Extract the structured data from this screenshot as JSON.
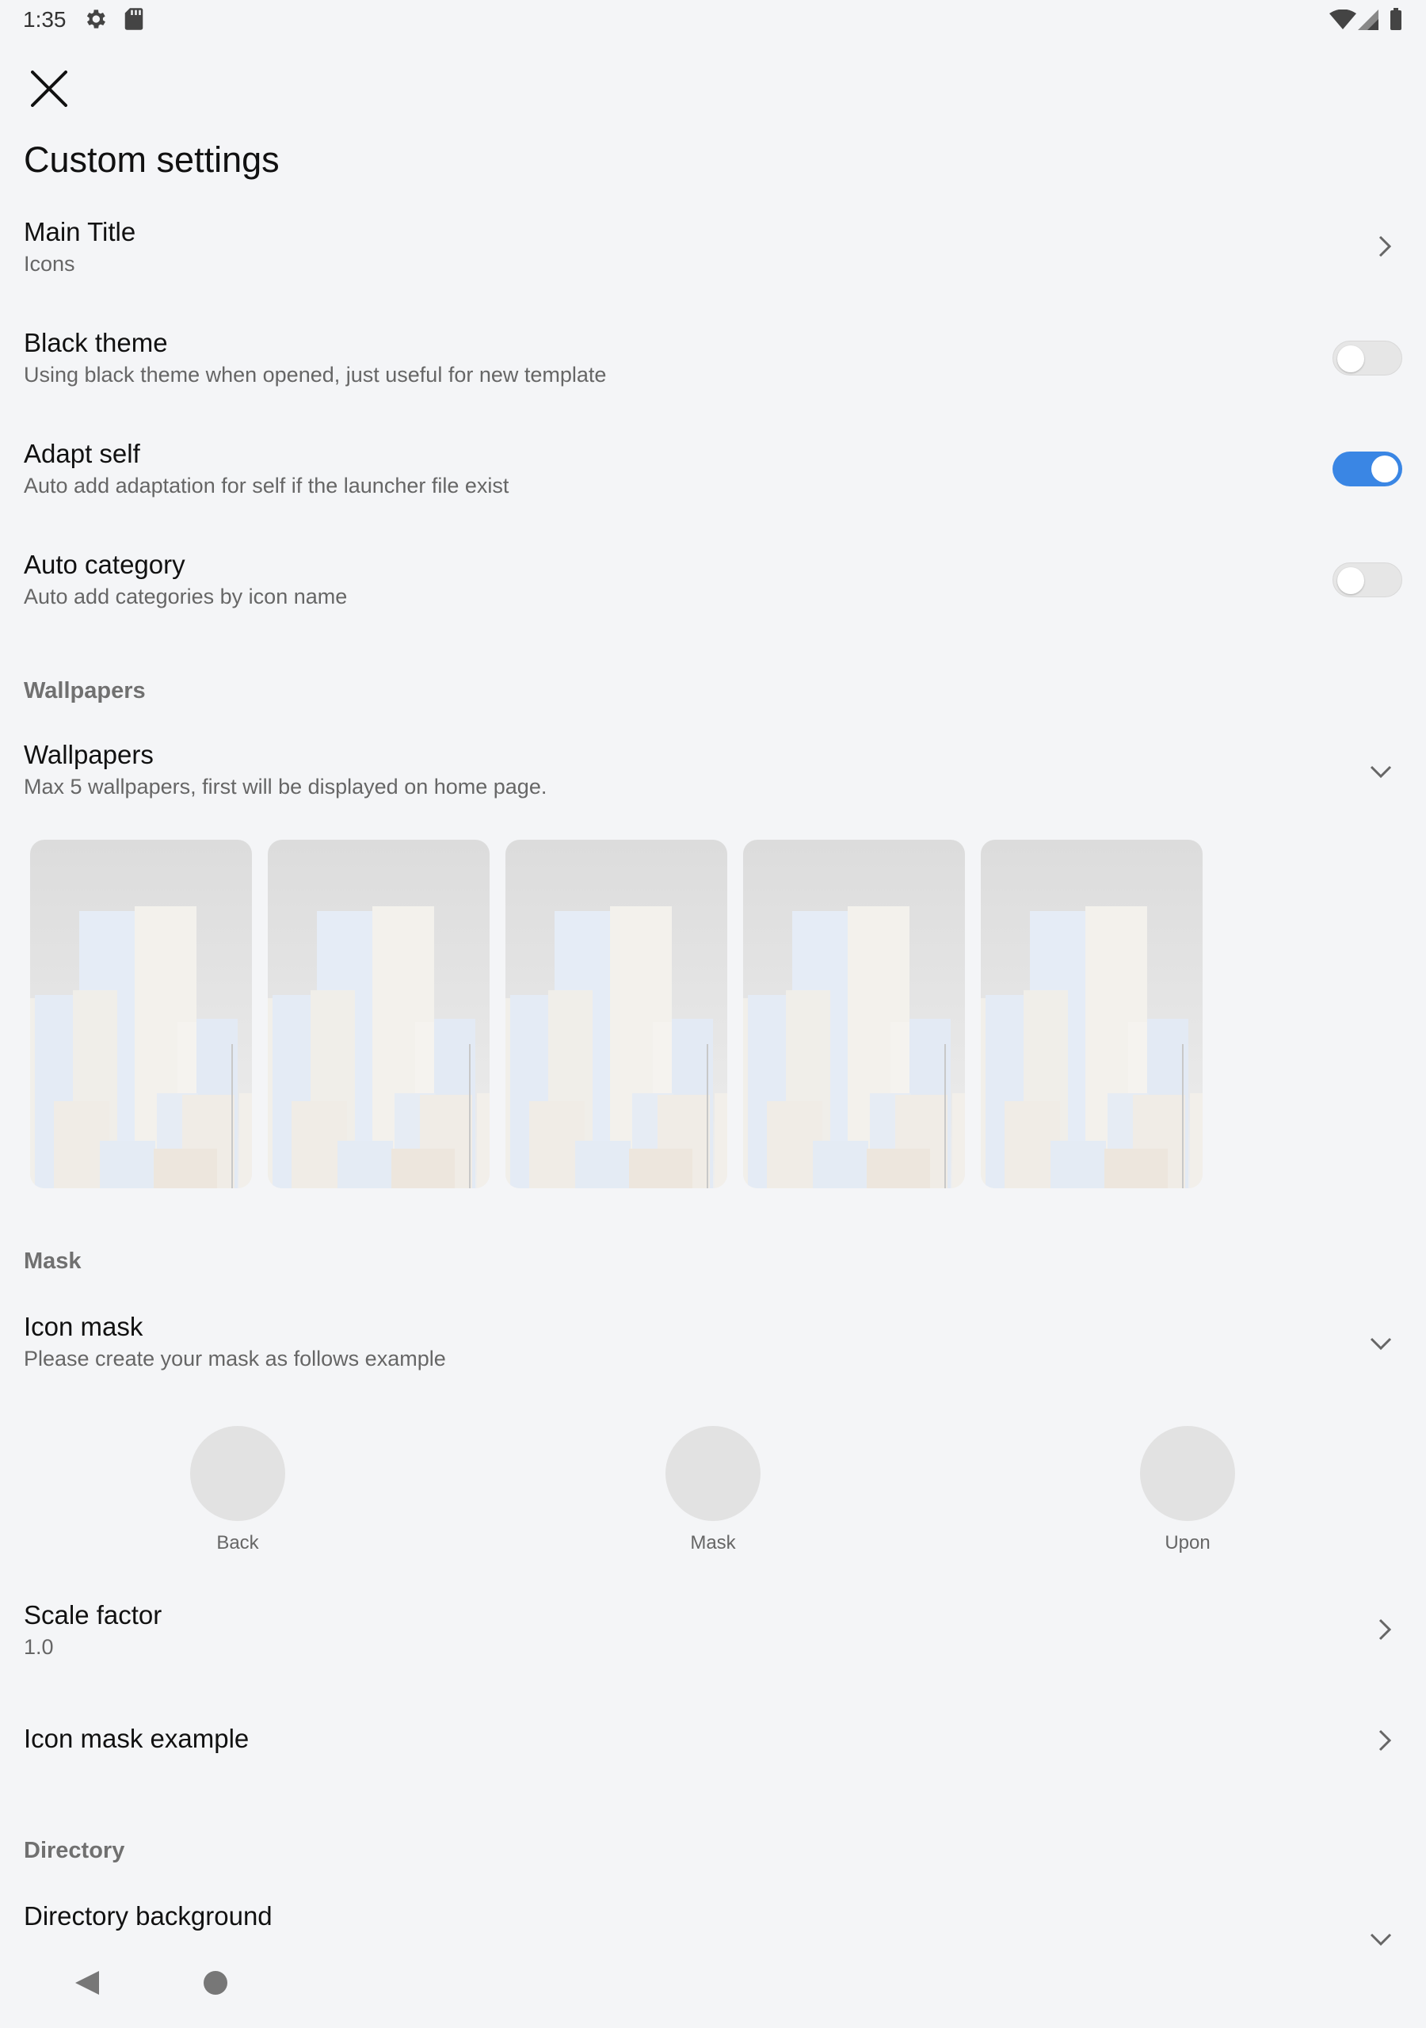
{
  "status": {
    "time": "1:35"
  },
  "page": {
    "title": "Custom settings"
  },
  "settings": {
    "main_title": {
      "label": "Main Title",
      "value": "Icons"
    },
    "black_theme": {
      "label": "Black theme",
      "description": "Using black theme when opened, just useful for new template",
      "enabled": false
    },
    "adapt_self": {
      "label": "Adapt self",
      "description": "Auto add adaptation for self if the launcher file exist",
      "enabled": true
    },
    "auto_category": {
      "label": "Auto category",
      "description": "Auto add categories by icon name",
      "enabled": false
    }
  },
  "wallpapers_section": {
    "header": "Wallpapers",
    "title": "Wallpapers",
    "description": "Max 5 wallpapers, first will be displayed on home page.",
    "count": 5
  },
  "mask_section": {
    "header": "Mask",
    "title": "Icon mask",
    "description": "Please create your mask as follows example",
    "items": [
      "Back",
      "Mask",
      "Upon"
    ]
  },
  "scale_factor": {
    "label": "Scale factor",
    "value": "1.0"
  },
  "icon_mask_example": {
    "label": "Icon mask example"
  },
  "directory_section": {
    "header": "Directory",
    "title": "Directory background"
  },
  "colors": {
    "accent": "#3a86e4",
    "background": "#f4f5f7"
  },
  "icons": [
    "settings-gear-icon",
    "sd-card-icon",
    "wifi-icon",
    "signal-icon",
    "battery-icon",
    "close-icon",
    "chevron-right-icon",
    "chevron-down-icon",
    "nav-back-icon",
    "nav-home-icon"
  ]
}
